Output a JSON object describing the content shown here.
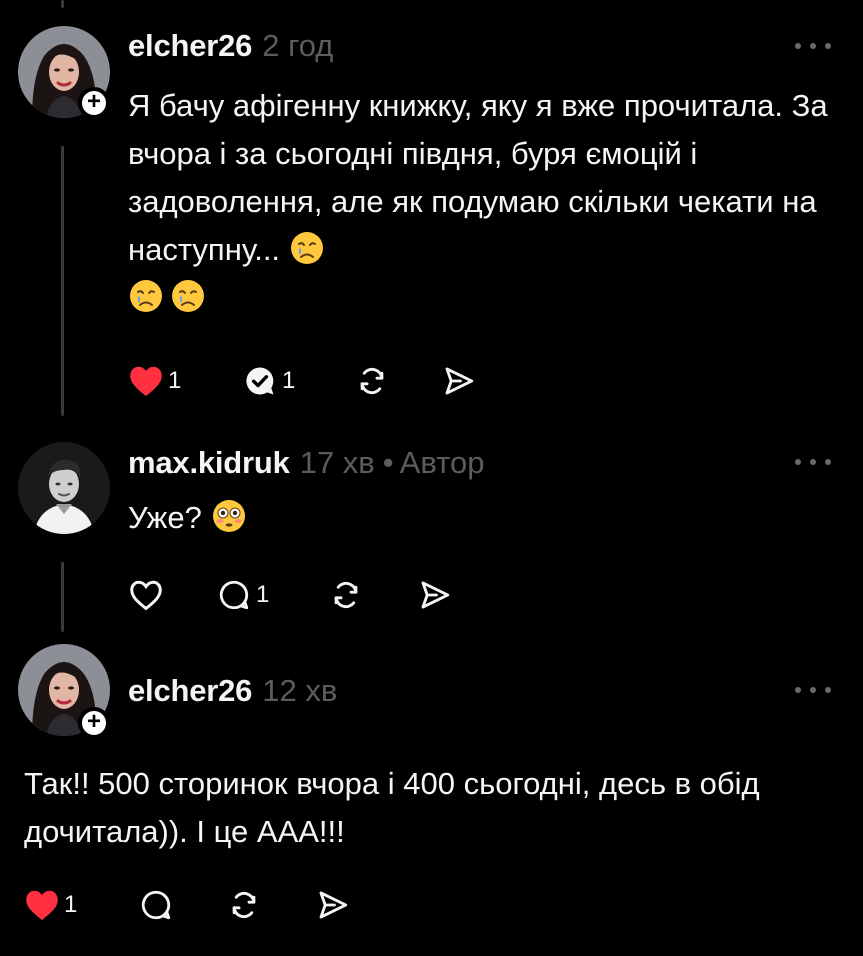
{
  "comments": [
    {
      "username": "elcher26",
      "time": "2 год",
      "text": "Я бачу афігенну книжку, яку я вже прочитала. За вчора і за сьогодні півдня, буря ємоцій і задоволення, але як подумаю скільки чекати на наступну...",
      "likes": "1",
      "replies": "1",
      "liked": true,
      "avatar_icon": "woman-avatar",
      "follow_badge": "+"
    },
    {
      "username": "max.kidruk",
      "time": "17 хв",
      "separator": "•",
      "author_label": "Автор",
      "text": "Уже?",
      "replies": "1",
      "liked": false,
      "avatar_icon": "man-avatar"
    },
    {
      "username": "elcher26",
      "time": "12 хв",
      "text": "Так!! 500 сторинок вчора і 400 сьогодні, десь в обід дочитала)). І це ААА!!!",
      "likes": "1",
      "liked": true,
      "avatar_icon": "woman-avatar",
      "follow_badge": "+"
    }
  ],
  "colors": {
    "background": "#000000",
    "text": "#f3f5f7",
    "muted": "#5c5c5c",
    "like_red": "#ff3040"
  },
  "icons": [
    "heart-icon",
    "comment-icon",
    "repost-icon",
    "share-icon",
    "more-icon",
    "crying-face-emoji",
    "flushed-face-emoji"
  ]
}
